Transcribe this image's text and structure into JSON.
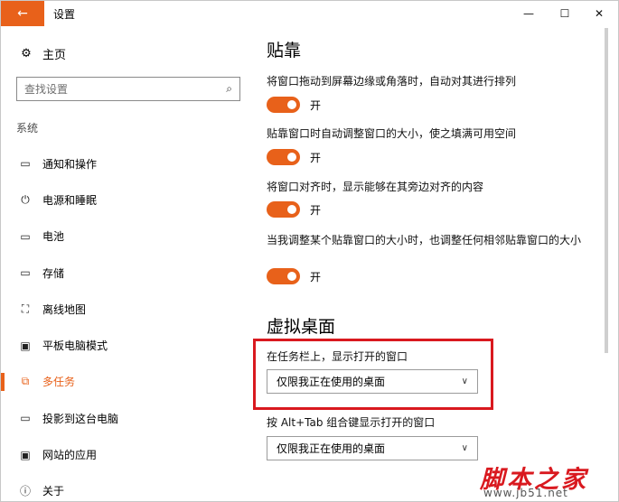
{
  "titlebar": {
    "title": "设置",
    "back_icon": "←",
    "minimize_icon": "—",
    "maximize_icon": "☐",
    "close_icon": "✕"
  },
  "sidebar": {
    "home": {
      "label": "主页",
      "icon": "⚙"
    },
    "search": {
      "placeholder": "查找设置",
      "icon": "⌕"
    },
    "section": "系统",
    "items": [
      {
        "label": "通知和操作",
        "icon": "▭"
      },
      {
        "label": "电源和睡眠",
        "icon": "⏻"
      },
      {
        "label": "电池",
        "icon": "▭"
      },
      {
        "label": "存储",
        "icon": "▭"
      },
      {
        "label": "离线地图",
        "icon": "⛶"
      },
      {
        "label": "平板电脑模式",
        "icon": "▣"
      },
      {
        "label": "多任务",
        "icon": "⧉"
      },
      {
        "label": "投影到这台电脑",
        "icon": "▭"
      },
      {
        "label": "网站的应用",
        "icon": "▣"
      },
      {
        "label": "关于",
        "icon": "ⓘ"
      }
    ]
  },
  "main": {
    "snap": {
      "title": "贴靠",
      "options": [
        {
          "description": "将窗口拖动到屏幕边缘或角落时，自动对其进行排列",
          "state": "开"
        },
        {
          "description": "贴靠窗口时自动调整窗口的大小，使之填满可用空间",
          "state": "开"
        },
        {
          "description": "将窗口对齐时，显示能够在其旁边对齐的内容",
          "state": "开"
        },
        {
          "description": "当我调整某个贴靠窗口的大小时，也调整任何相邻贴靠窗口的大小",
          "state": "开"
        }
      ]
    },
    "virtual_desktops": {
      "title": "虚拟桌面",
      "taskbar": {
        "label": "在任务栏上，显示打开的窗口",
        "value": "仅限我正在使用的桌面"
      },
      "alt_tab": {
        "label": "按 Alt+Tab 组合键显示打开的窗口",
        "value": "仅限我正在使用的桌面"
      }
    }
  },
  "watermark": {
    "text": "脚本之家",
    "url": "www.jb51.net"
  },
  "colors": {
    "accent": "#e8611a",
    "highlight": "#d9191f"
  }
}
